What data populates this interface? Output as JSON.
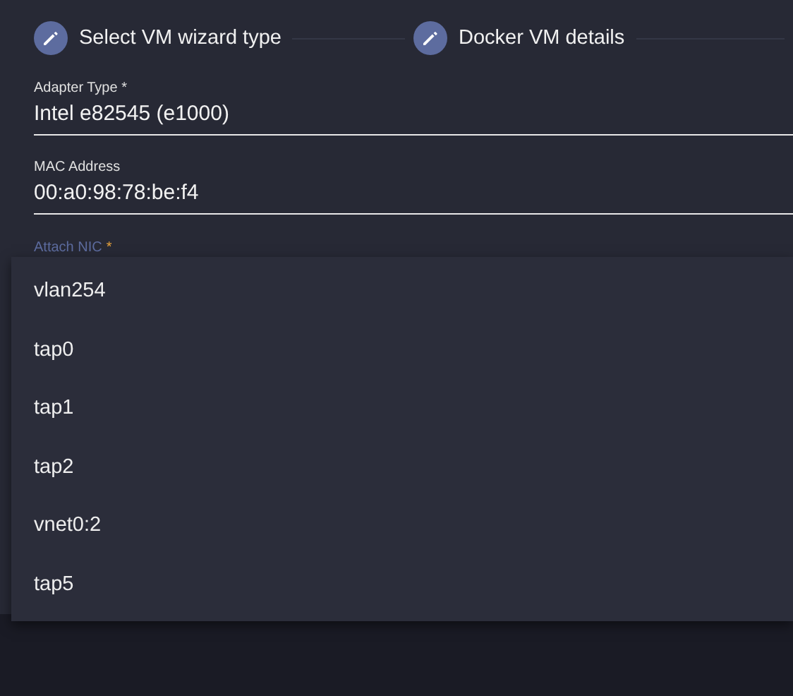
{
  "stepper": {
    "steps": [
      {
        "label": "Select VM wizard type"
      },
      {
        "label": "Docker VM details"
      }
    ]
  },
  "fields": [
    {
      "label": "Adapter Type *",
      "value": "Intel e82545 (e1000)"
    },
    {
      "label": "MAC Address",
      "value": "00:a0:98:78:be:f4"
    }
  ],
  "select": {
    "label": "Attach NIC",
    "required_mark": "*"
  },
  "dropdown": {
    "options": [
      {
        "label": "vlan254"
      },
      {
        "label": "tap0"
      },
      {
        "label": "tap1"
      },
      {
        "label": "tap2"
      },
      {
        "label": "vnet0:2"
      },
      {
        "label": "tap5"
      }
    ]
  }
}
